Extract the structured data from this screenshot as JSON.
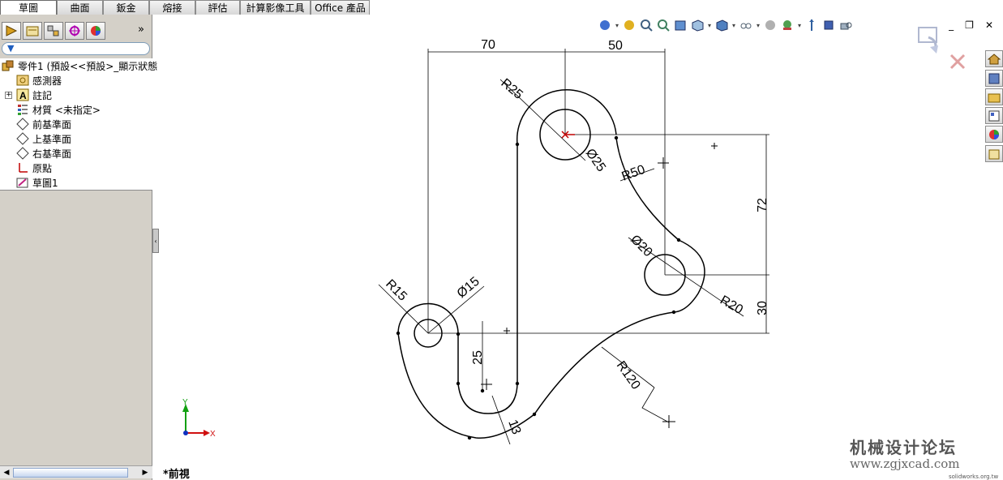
{
  "tabs": [
    "草圖",
    "曲面",
    "鈑金",
    "熔接",
    "評估",
    "計算影像工具",
    "Office 產品"
  ],
  "active_tab": "草圖",
  "panel_toolbar_icons": [
    "feature-manager-icon",
    "property-manager-icon",
    "configuration-manager-icon",
    "dimxpert-icon",
    "display-manager-icon"
  ],
  "tree": {
    "root": "零件1  (預設<<預設>_顯示狀態",
    "items": [
      "感測器",
      "註記",
      "材質 <未指定>",
      "前基準面",
      "上基準面",
      "右基準面",
      "原點",
      "草圖1"
    ]
  },
  "view_label": "*前視",
  "drawing": {
    "dimensions": {
      "d70": "70",
      "d50": "50",
      "d72": "72",
      "d30": "30",
      "d25": "25",
      "d13": "13",
      "r25": "R25",
      "dia25": "Ø25",
      "r50": "R50",
      "dia20": "Ø20",
      "r20": "R20",
      "r15": "R15",
      "dia15": "Ø15",
      "r120": "R120"
    },
    "axes": {
      "y": "Y",
      "x": "X"
    }
  },
  "watermark": {
    "title": "机械设计论坛",
    "url": "www.zgjxcad.com",
    "small": "solidworks.org.tw"
  },
  "colors": {
    "background": "#ffffff",
    "panel": "#d4d0c8",
    "geometry": "#000000",
    "dimension": "#000000",
    "origin": "#c00000"
  }
}
